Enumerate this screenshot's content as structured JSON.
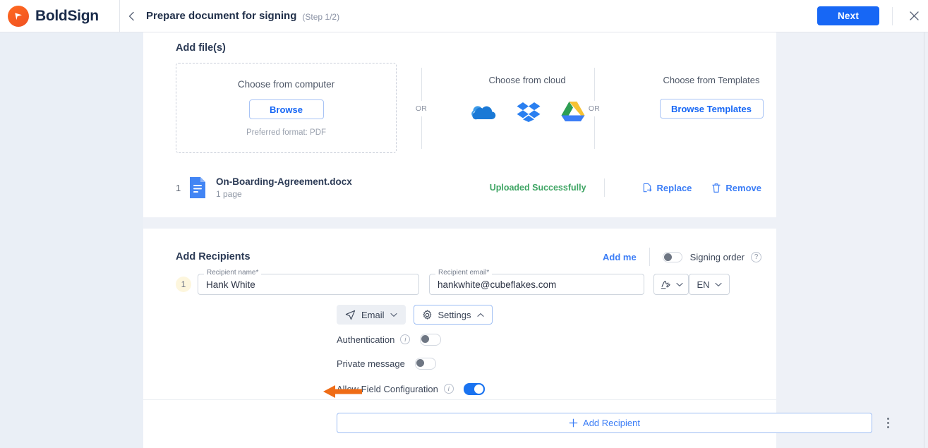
{
  "topbar": {
    "brand_name": "BoldSign",
    "brand_icon": "boldsign-logo-icon",
    "back_icon": "chevron-left-icon",
    "title": "Prepare document for signing",
    "step": "(Step 1/2)",
    "next_label": "Next",
    "close_icon": "close-icon"
  },
  "files": {
    "section_title": "Add file(s)",
    "dropzone": {
      "title": "Choose from computer",
      "browse_label": "Browse",
      "note": "Preferred format: PDF"
    },
    "or_left": "OR",
    "or_right": "OR",
    "cloud": {
      "title": "Choose from cloud",
      "providers": [
        "onedrive-icon",
        "dropbox-icon",
        "google-drive-icon"
      ]
    },
    "templates": {
      "title": "Choose from Templates",
      "browse_label": "Browse Templates"
    },
    "uploaded": {
      "index": "1",
      "name": "On-Boarding-Agreement.docx",
      "pages": "1 page",
      "status": "Uploaded Successfully",
      "replace_label": "Replace",
      "remove_label": "Remove",
      "file_icon": "docx-file-icon",
      "replace_icon": "replace-icon",
      "remove_icon": "trash-icon"
    }
  },
  "recipients": {
    "section_title": "Add Recipients",
    "add_me_label": "Add me",
    "signing_order_label": "Signing order",
    "signing_order_on": false,
    "help_glyph": "?",
    "info_glyph": "i",
    "rows": [
      {
        "badge": "1",
        "name_label": "Recipient name*",
        "name_value": "Hank White",
        "email_label": "Recipient email*",
        "email_value": "hankwhite@cubeflakes.com",
        "role_icon": "signature-icon",
        "language": "EN",
        "mode_label": "Email",
        "mode_icon": "send-icon",
        "settings_label": "Settings",
        "settings_icon": "gear-icon",
        "options": [
          {
            "label": "Authentication",
            "has_info": true,
            "on": false
          },
          {
            "label": "Private message",
            "has_info": false,
            "on": false
          },
          {
            "label": "Allow Field Configuration",
            "has_info": true,
            "on": true
          }
        ]
      }
    ],
    "add_recipient_label": "Add Recipient",
    "add_recipient_icon": "plus-icon",
    "more_icon": "kebab-menu-icon"
  },
  "annotation": {
    "arrow_color": "#ef6c16",
    "arrow_icon": "left-arrow-annotation"
  },
  "colors": {
    "accent_blue": "#1767f5",
    "brand_orange": "#f05123",
    "success_green": "#3fa564",
    "page_bg": "#eef1f7"
  }
}
